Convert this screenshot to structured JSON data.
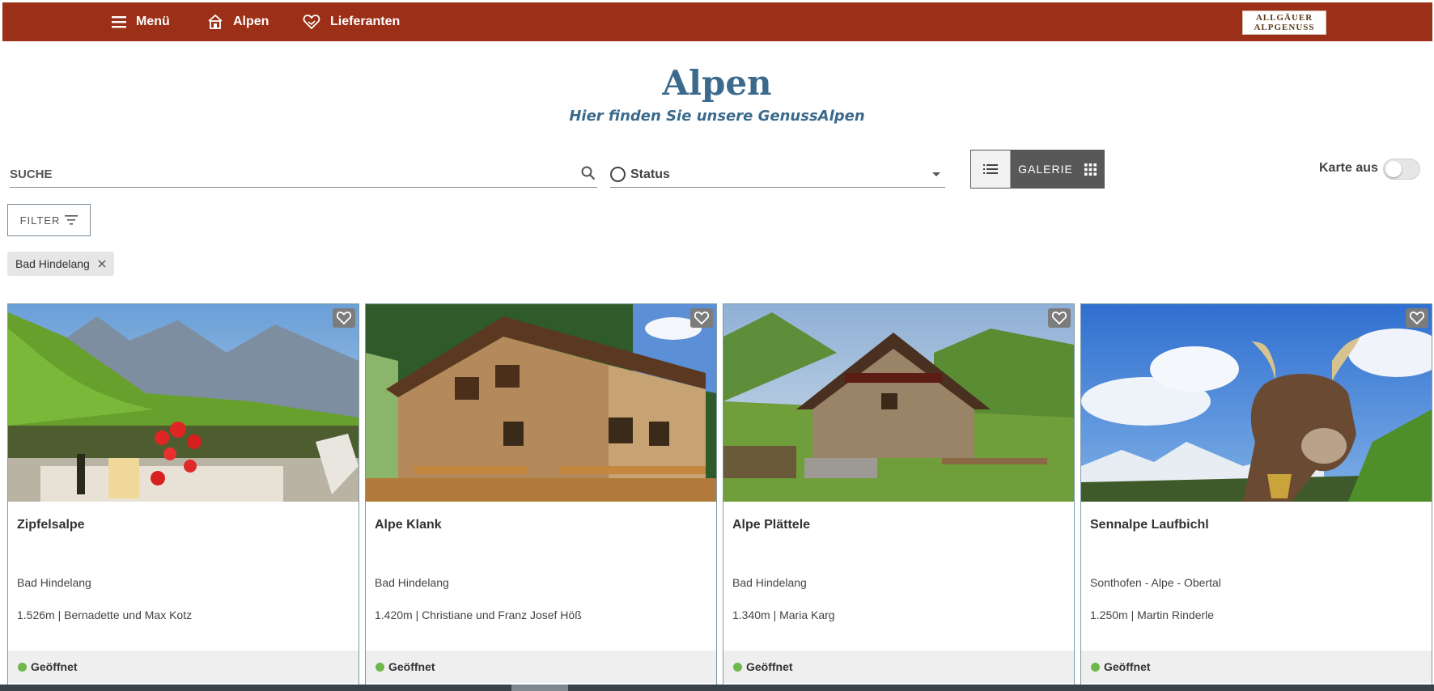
{
  "nav": {
    "menu_label": "Menü",
    "alpen_label": "Alpen",
    "lieferanten_label": "Lieferanten",
    "logo_line1": "ALLGÄUER",
    "logo_line2": "ALPGENUSS",
    "background_color": "#9b2f17"
  },
  "header": {
    "title": "Alpen",
    "subtitle": "Hier finden Sie unsere GenussAlpen",
    "color": "#3b6a8c"
  },
  "search": {
    "placeholder": "SUCHE",
    "value": ""
  },
  "status_select": {
    "label": "Status"
  },
  "view_toggle": {
    "gallery_label": "GALERIE",
    "active": "gallery"
  },
  "map_toggle": {
    "label": "Karte aus",
    "enabled": false
  },
  "filter": {
    "button_label": "FILTER",
    "active_chips": [
      "Bad Hindelang"
    ]
  },
  "cards": [
    {
      "title": "Zipfelsalpe",
      "location": "Bad Hindelang",
      "details": "1.526m | Bernadette und Max Kotz",
      "status": "Geöffnet"
    },
    {
      "title": "Alpe Klank",
      "location": "Bad Hindelang",
      "details": "1.420m | Christiane und Franz Josef Höß",
      "status": "Geöffnet"
    },
    {
      "title": "Alpe Plättele",
      "location": "Bad Hindelang",
      "details": "1.340m | Maria Karg",
      "status": "Geöffnet"
    },
    {
      "title": "Sennalpe Laufbichl",
      "location": "Sonthofen - Alpe - Obertal",
      "details": "1.250m | Martin Rinderle",
      "status": "Geöffnet"
    }
  ],
  "status_color": "#6fb84a"
}
